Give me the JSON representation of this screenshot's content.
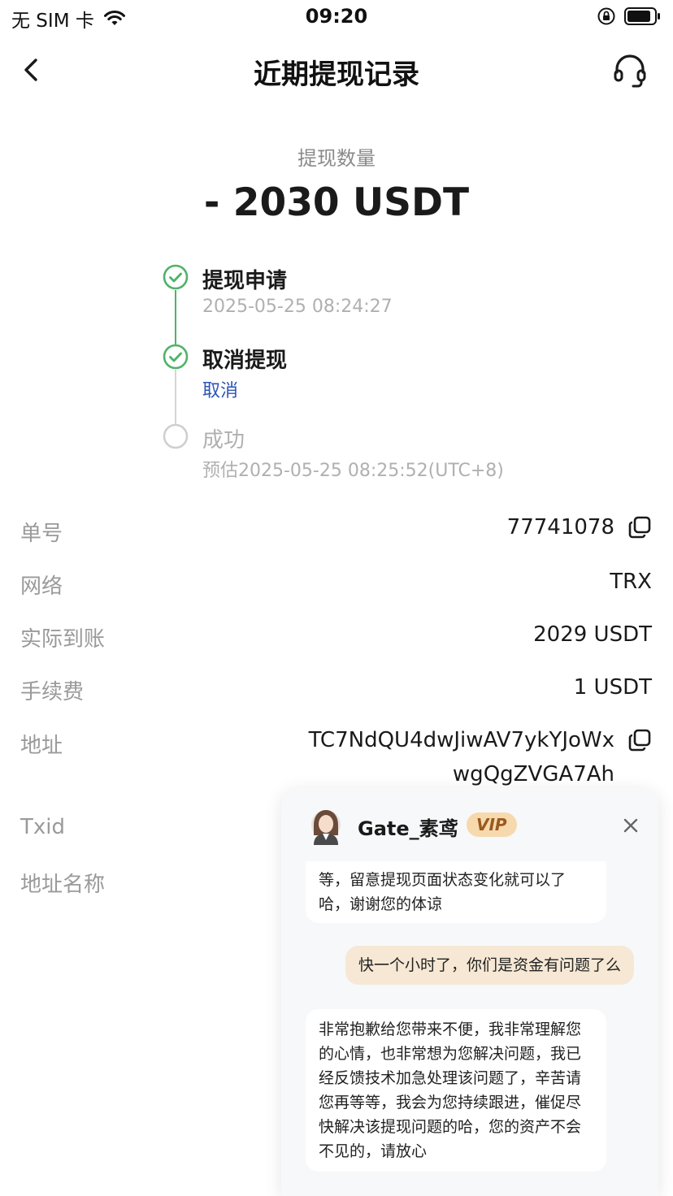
{
  "status_bar": {
    "carrier": "无 SIM 卡",
    "time": "09:20"
  },
  "nav": {
    "title": "近期提现记录",
    "back_icon": "chevron-left-icon",
    "support_icon": "headset-icon"
  },
  "amount": {
    "label": "提现数量",
    "value": "- 2030 USDT"
  },
  "timeline": [
    {
      "title": "提现申请",
      "subtitle": "2025-05-25 08:24:27",
      "status": "done"
    },
    {
      "title": "取消提现",
      "subtitle": "取消",
      "status": "done"
    },
    {
      "title": "成功",
      "subtitle": "预估2025-05-25 08:25:52(UTC+8)",
      "status": "pending"
    }
  ],
  "details": {
    "order_label": "单号",
    "order_value": "77741078",
    "network_label": "网络",
    "network_value": "TRX",
    "received_label": "实际到账",
    "received_value": "2029 USDT",
    "fee_label": "手续费",
    "fee_value": "1 USDT",
    "address_label": "地址",
    "address_line1": "TC7NdQU4dwJiwAV7ykYJoWx",
    "address_line2": "wgQgZVGA7Ah",
    "txid_label": "Txid",
    "address_name_label": "地址名称"
  },
  "chat": {
    "agent_name": "Gate_素鸢",
    "badge": "VIP",
    "messages": [
      {
        "from": "agent",
        "lines": [
          "等，留意提现页面状态变化就可以了",
          "哈，谢谢您的体谅"
        ]
      },
      {
        "from": "user",
        "lines": [
          "快一个小时了，你们是资金有问题了么"
        ]
      },
      {
        "from": "agent",
        "lines": [
          "非常抱歉给您带来不便，我非常理解您",
          "的心情，也非常想为您解决问题，我已",
          "经反馈技术加急处理该问题了，辛苦请",
          "您再等等，我会为您持续跟进，催促尽",
          "快解决该提现问题的哈，您的资产不会",
          "不见的，请放心"
        ]
      }
    ]
  },
  "colors": {
    "accent_green": "#4fb26a",
    "link_blue": "#2c55b5",
    "vip_bg": "#f7d9ae",
    "user_bubble": "#f6e8d4"
  }
}
